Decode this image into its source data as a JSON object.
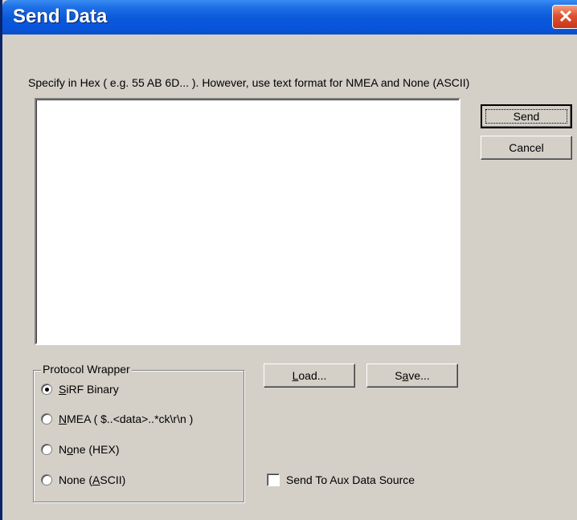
{
  "window": {
    "title": "Send Data",
    "close_glyph": "✕"
  },
  "description": "Specify in Hex ( e.g. 55 AB 6D... ).  However, use text format for NMEA and None (ASCII)",
  "message_input": {
    "value": ""
  },
  "buttons": {
    "send": "Send",
    "cancel": "Cancel",
    "load": {
      "pre": "",
      "mnemonic": "L",
      "post": "oad..."
    },
    "save": {
      "pre": "S",
      "mnemonic": "a",
      "post": "ve..."
    }
  },
  "protocol_wrapper": {
    "legend": "Protocol Wrapper",
    "options": [
      {
        "pre": "",
        "mnemonic": "S",
        "post": "iRF Binary",
        "checked": true
      },
      {
        "pre": "",
        "mnemonic": "N",
        "post": "MEA ( $..<data>..*ck\\r\\n )",
        "checked": false
      },
      {
        "pre": "N",
        "mnemonic": "o",
        "post": "ne (HEX)",
        "checked": false
      },
      {
        "pre": "None (",
        "mnemonic": "A",
        "post": "SCII)",
        "checked": false
      }
    ]
  },
  "aux_source": {
    "label": "Send To Aux Data Source",
    "checked": false
  },
  "colors": {
    "titlebar": "#0a58d8",
    "dialog": "#d4d0c8",
    "close": "#e05030"
  }
}
